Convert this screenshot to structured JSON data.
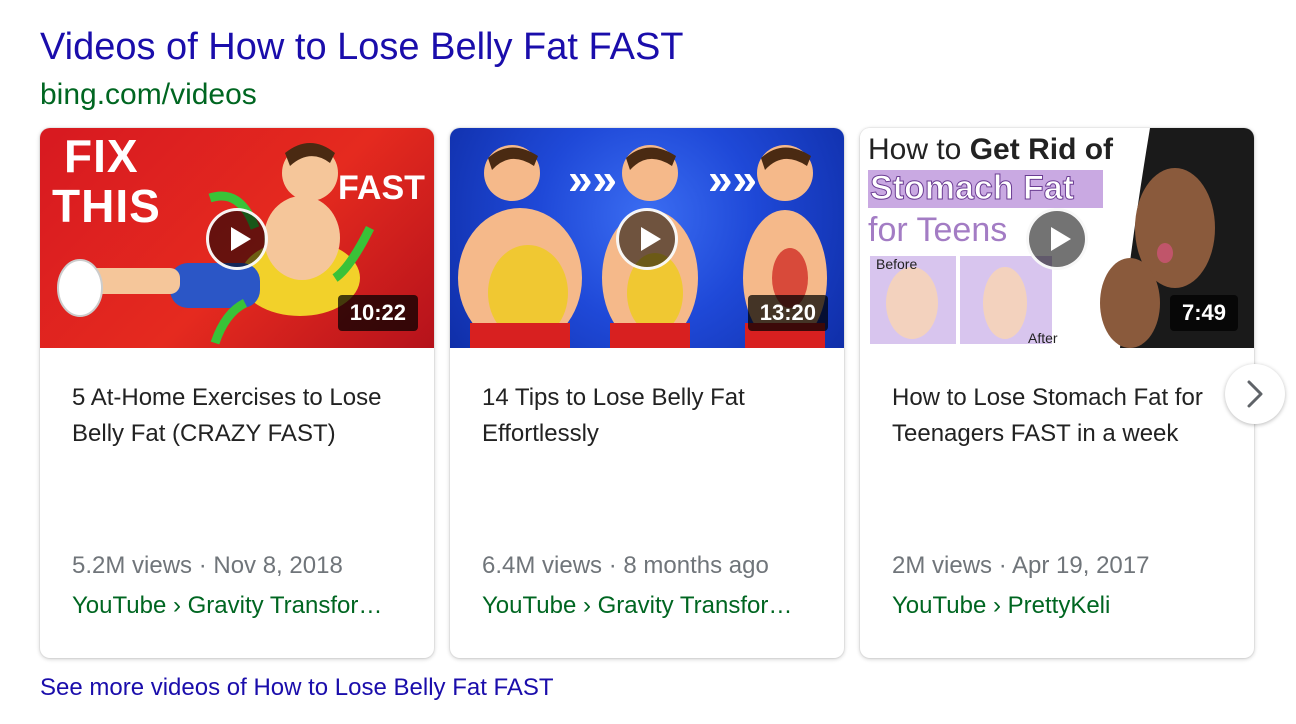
{
  "header": {
    "title": "Videos of How to Lose Belly Fat FAST",
    "source_url": "bing.com/videos"
  },
  "videos": [
    {
      "title": "5 At-Home Exercises to Lose Belly Fat (CRAZY FAST)",
      "duration": "10:22",
      "views_date": "5.2M views · Nov 8, 2018",
      "source": "YouTube › Gravity Transfor…",
      "thumb_text": {
        "line1": "FIX",
        "line2": "THIS",
        "side": "FAST"
      }
    },
    {
      "title": "14 Tips to Lose Belly Fat Effortlessly",
      "duration": "13:20",
      "views_date": "6.4M views · 8 months ago",
      "source": "YouTube › Gravity Transfor…",
      "thumb_text": {
        "arrows": "»»"
      }
    },
    {
      "title": "How to Lose Stomach Fat for Teenagers FAST in a week",
      "duration": "7:49",
      "views_date": "2M views · Apr 19, 2017",
      "source": "YouTube › PrettyKeli",
      "thumb_text": {
        "line1_a": "How to ",
        "line1_b": "Get Rid of",
        "line2": "Stomach Fat",
        "line3": "for Teens",
        "before": "Before",
        "after": "After"
      }
    }
  ],
  "controls": {
    "next_icon": "chevron-right-icon",
    "play_icon": "play-icon"
  },
  "footer": {
    "see_more": "See more videos of How to Lose Belly Fat FAST"
  },
  "colors": {
    "link": "#1a0dab",
    "url_green": "#006621",
    "meta_gray": "#70757a",
    "thumb1_red": "#d71920",
    "thumb2_blue": "#1f49d8"
  }
}
